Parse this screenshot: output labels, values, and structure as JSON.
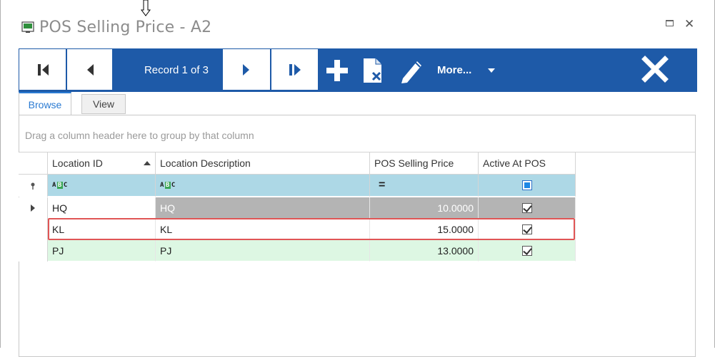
{
  "window": {
    "title": "POS Selling Price - A2",
    "maximize_icon": "maximize-icon",
    "close_icon": "close-icon"
  },
  "toolbar": {
    "record_label": "Record 1 of 3",
    "more_label": "More...",
    "icons": [
      "first-record-icon",
      "prev-record-icon",
      "next-record-icon",
      "last-record-icon",
      "add-icon",
      "delete-icon",
      "edit-icon",
      "close-form-icon"
    ],
    "background_color": "#1e5aa8"
  },
  "tabs": [
    {
      "label": "Browse",
      "active": true
    },
    {
      "label": "View",
      "active": false
    }
  ],
  "grid": {
    "group_hint": "Drag a column header here to group by that column",
    "columns": [
      {
        "label": "Location ID",
        "sorted": "ascending"
      },
      {
        "label": "Location Description"
      },
      {
        "label": "POS Selling Price"
      },
      {
        "label": "Active At POS"
      }
    ],
    "filter_row": {
      "location_id": "A B C",
      "location_description": "A B C",
      "pos_selling_price": "=",
      "active_at_pos": "checked"
    },
    "rows": [
      {
        "location_id": "HQ",
        "location_description": "HQ",
        "pos_selling_price": "10.0000",
        "active_at_pos": true,
        "current": true
      },
      {
        "location_id": "KL",
        "location_description": "KL",
        "pos_selling_price": "15.0000",
        "active_at_pos": true,
        "highlighted": true
      },
      {
        "location_id": "PJ",
        "location_description": "PJ",
        "pos_selling_price": "13.0000",
        "active_at_pos": true
      }
    ],
    "colors": {
      "filter_row": "#add8e6",
      "selected_row": "#b4b4b4",
      "alt_row": "#ddf7e3",
      "highlight_border": "#e05555"
    }
  }
}
